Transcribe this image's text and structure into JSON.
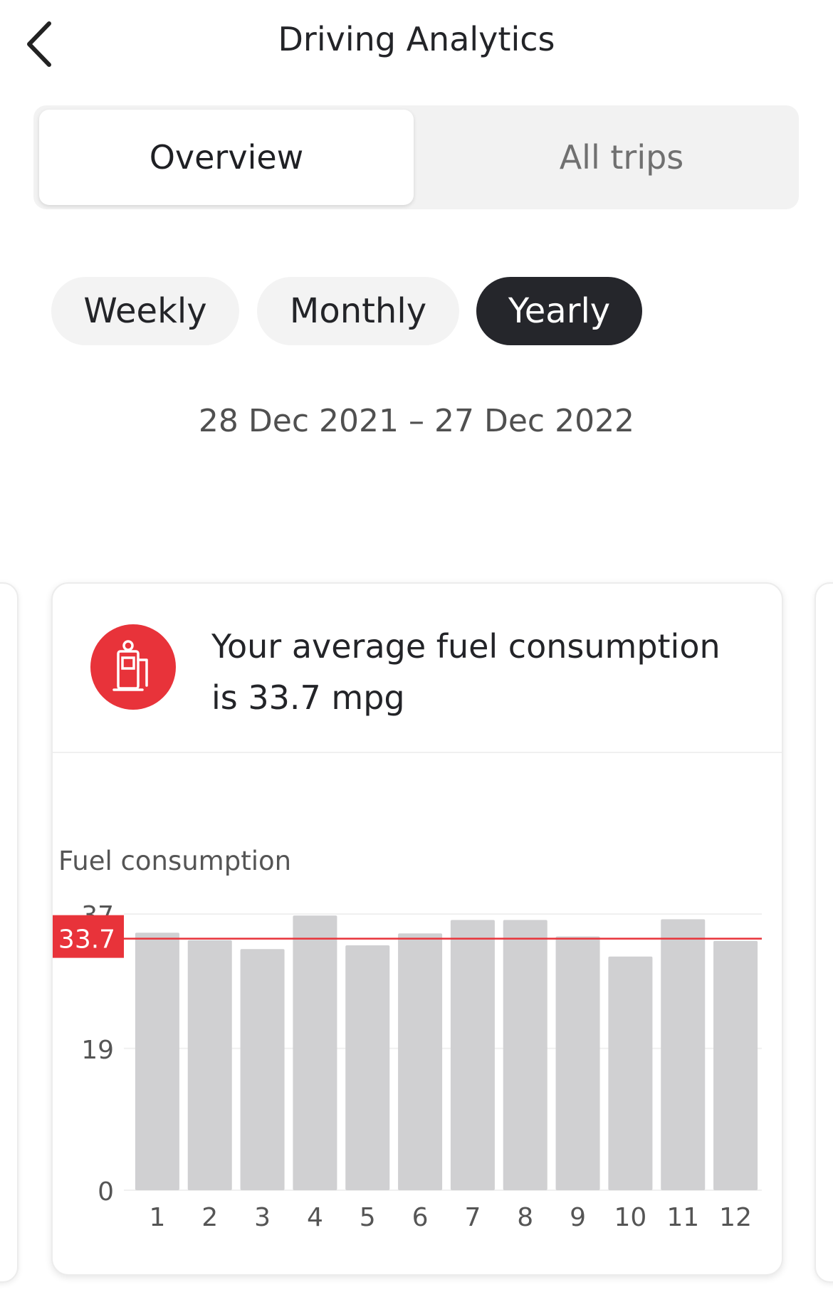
{
  "header": {
    "title": "Driving Analytics",
    "back_icon": "chevron-left-icon"
  },
  "segmented": {
    "active": "Overview",
    "inactive": "All trips"
  },
  "periods": [
    {
      "label": "Weekly",
      "selected": false
    },
    {
      "label": "Monthly",
      "selected": false
    },
    {
      "label": "Yearly",
      "selected": true
    }
  ],
  "date_range": "28 Dec 2021 – 27 Dec 2022",
  "card": {
    "icon": "fuel-pump-icon",
    "message_line1": "Your average fuel consumption",
    "message_line2": "is 33.7 mpg",
    "chart_label": "Fuel consumption"
  },
  "colors": {
    "accent_red": "#e8333a",
    "bar_gray": "#d0d0d2",
    "dark_pill": "#25262b"
  },
  "chart_data": {
    "type": "bar",
    "categories": [
      "1",
      "2",
      "3",
      "4",
      "5",
      "6",
      "7",
      "8",
      "9",
      "10",
      "11",
      "12"
    ],
    "values": [
      34.5,
      33.5,
      32.3,
      36.8,
      32.8,
      34.4,
      36.2,
      36.2,
      34.0,
      31.3,
      36.3,
      33.4
    ],
    "yticks": [
      "0",
      "19",
      "37"
    ],
    "ylim": [
      0,
      37
    ],
    "average": 33.7,
    "average_label": "33.7"
  }
}
